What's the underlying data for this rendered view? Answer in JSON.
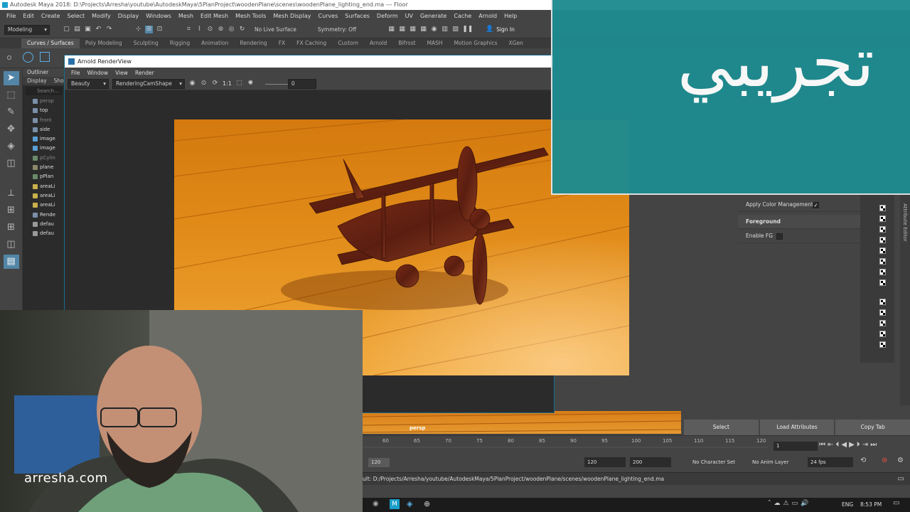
{
  "window": {
    "title": "Autodesk Maya 2018: D:\\Projects\\Arresha\\youtube\\AutodeskMaya\\5PlanProject\\woodenPlane\\scenes\\woodenPlane_lighting_end.ma  ---  Floor"
  },
  "menubar": [
    "File",
    "Edit",
    "Create",
    "Select",
    "Modify",
    "Display",
    "Windows",
    "Mesh",
    "Edit Mesh",
    "Mesh Tools",
    "Mesh Display",
    "Curves",
    "Surfaces",
    "Deform",
    "UV",
    "Generate",
    "Cache",
    "Arnold",
    "Help"
  ],
  "statusline": {
    "mode": "Modeling",
    "live_surface": "No Live Surface",
    "symmetry": "Symmetry: Off",
    "sign_in": "Sign In"
  },
  "shelf_tabs": [
    "Curves / Surfaces",
    "Poly Modeling",
    "Sculpting",
    "Rigging",
    "Animation",
    "Rendering",
    "FX",
    "FX Caching",
    "Custom",
    "Arnold",
    "Bifrost",
    "MASH",
    "Motion Graphics",
    "XGen"
  ],
  "outliner": {
    "title": "Outliner",
    "menu": [
      "Display",
      "Show"
    ],
    "search_placeholder": "Search...",
    "items": [
      {
        "label": "persp",
        "dim": true
      },
      {
        "label": "top",
        "dim": false
      },
      {
        "label": "front",
        "dim": true
      },
      {
        "label": "side",
        "dim": false
      },
      {
        "label": "image",
        "dim": false
      },
      {
        "label": "image",
        "dim": false
      },
      {
        "label": "pCylin",
        "dim": true
      },
      {
        "label": "plane",
        "dim": false
      },
      {
        "label": "pPlan",
        "dim": false
      },
      {
        "label": "areaLi",
        "dim": false
      },
      {
        "label": "areaLi",
        "dim": false
      },
      {
        "label": "areaLi",
        "dim": false
      },
      {
        "label": "Rende",
        "dim": false
      },
      {
        "label": "defau",
        "dim": false
      },
      {
        "label": "defau",
        "dim": false
      }
    ]
  },
  "renderview": {
    "title": "Arnold RenderView",
    "menu": [
      "File",
      "Window",
      "View",
      "Render"
    ],
    "aov": "Beauty",
    "camera": "RenderingCamShape",
    "ratio": "1:1",
    "exposure": "0"
  },
  "attribute_editor": {
    "apply_color_management_label": "Apply Color Management",
    "apply_color_management": true,
    "foreground_header": "Foreground",
    "enable_fg_label": "Enable FG",
    "enable_fg": false,
    "tab_label": "Attribute Editor",
    "buttons": [
      "Select",
      "Load Attributes",
      "Copy Tab"
    ]
  },
  "viewport": {
    "label": "persp"
  },
  "timeline": {
    "ticks": [
      "60",
      "65",
      "70",
      "75",
      "80",
      "85",
      "90",
      "95",
      "100",
      "105",
      "110",
      "115",
      "120"
    ],
    "current_frame": "1"
  },
  "range": {
    "range_end": "120",
    "end": "120",
    "anim_end": "200",
    "character_set": "No Character Set",
    "anim_layer": "No Anim Layer",
    "fps": "24 fps"
  },
  "cmdline": {
    "text": "ult: D:/Projects/Arresha/youtube/AutodeskMaya/5PlanProject/woodenPlane/scenes/woodenPlane_lighting_end.ma"
  },
  "taskbar": {
    "lang": "ENG",
    "time": "8:53 PM"
  },
  "overlay": {
    "arabic_text": "تجريبي"
  },
  "webcam": {
    "watermark": "arresha.com"
  }
}
